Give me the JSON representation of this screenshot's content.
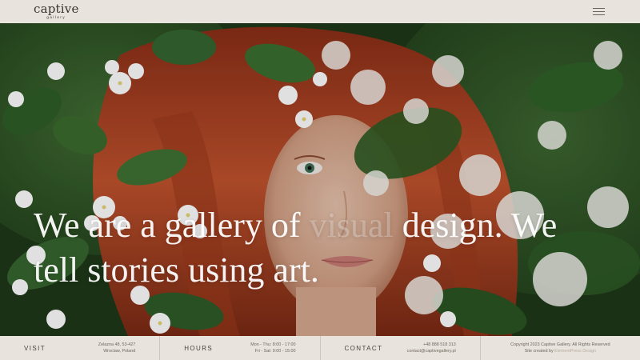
{
  "header": {
    "logo_word": "captive",
    "logo_sub": "gallery",
    "menu_icon": "hamburger-menu-icon"
  },
  "hero": {
    "image": "portrait-red-hair-white-flowers",
    "headline_part1": "We are a gallery of ",
    "headline_muted": "visual",
    "headline_part2": " design. We tell stories using art."
  },
  "footer": {
    "visit": {
      "label": "VISIT",
      "line1": "Zelazna 48, 53-427",
      "line2": "Wroclaw, Poland"
    },
    "hours": {
      "label": "HOURS",
      "line1": "Mon - Thu: 8:00 - 17:00",
      "line2": "Fri - Sat: 9:00 - 15:00"
    },
    "contact": {
      "label": "CONTACT",
      "line1": "+48 888 518 313",
      "line2": "contact@captivegallery.pl"
    },
    "copyright": {
      "line1": "Copyright 2023 Captive Gallery. All Rights Reserved",
      "line2_prefix": "Site created by ",
      "line2_link": "ElementPress Design"
    }
  },
  "colors": {
    "bar_bg": "#e8e3dc",
    "text_dark": "#3a342f",
    "hair": "#b4462a",
    "leaf": "#2f5a29"
  }
}
